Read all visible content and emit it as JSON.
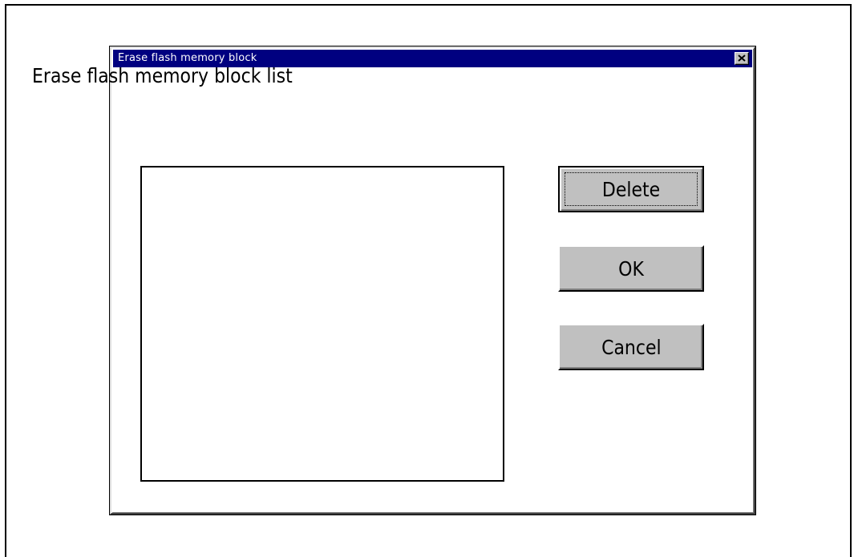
{
  "dialog": {
    "title": "Erase flash memory block",
    "close_icon": "close-icon",
    "list_label": "Erase flash memory block list",
    "list_items": [],
    "buttons": {
      "delete": "Delete",
      "ok": "OK",
      "cancel": "Cancel"
    }
  },
  "colors": {
    "titlebar": "#000080",
    "button_face": "#c0c0c0"
  }
}
